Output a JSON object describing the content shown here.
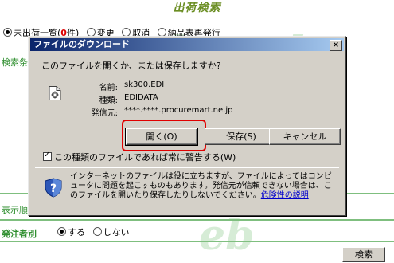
{
  "page": {
    "title": "出荷検索",
    "radio_options": [
      {
        "label": "未出荷一覧(",
        "count": "0",
        "suffix": "件)",
        "selected": true
      },
      {
        "label": "変更",
        "selected": false
      },
      {
        "label": "取消",
        "selected": false
      },
      {
        "label": "納品表再発行",
        "selected": false
      }
    ],
    "search_conditions_label": "検索条",
    "display_order_label": "表示順",
    "orderer_label": "発注者別",
    "orderer_options": [
      {
        "label": "する",
        "selected": true
      },
      {
        "label": "しない",
        "selected": false
      }
    ],
    "search_button": "検索",
    "watermark_text": "eb"
  },
  "dialog": {
    "title": "ファイルのダウンロード",
    "close_label": "×",
    "question": "このファイルを開くか、または保存しますか?",
    "file_icon": "document-gear-icon",
    "name_label": "名前:",
    "name_value": "sk300.EDI",
    "type_label": "種類:",
    "type_value": "EDIDATA",
    "from_label": "発信元:",
    "from_value": "****.****.procuremart.ne.jp",
    "open_button": "開く(O)",
    "save_button": "保存(S)",
    "cancel_button": "キャンセル",
    "always_ask_label": "この種類のファイルであれば常に警告する(W)",
    "always_ask_checked": true,
    "warning_icon": "shield-question-icon",
    "warning_text": "インターネットのファイルは役に立ちますが、ファイルによってはコンピュータに問題を起こすものもあります。発信元が信頼できない場合は、このファイルを開いたり保存したりしないでください。",
    "warning_link": "危険性の説明"
  }
}
